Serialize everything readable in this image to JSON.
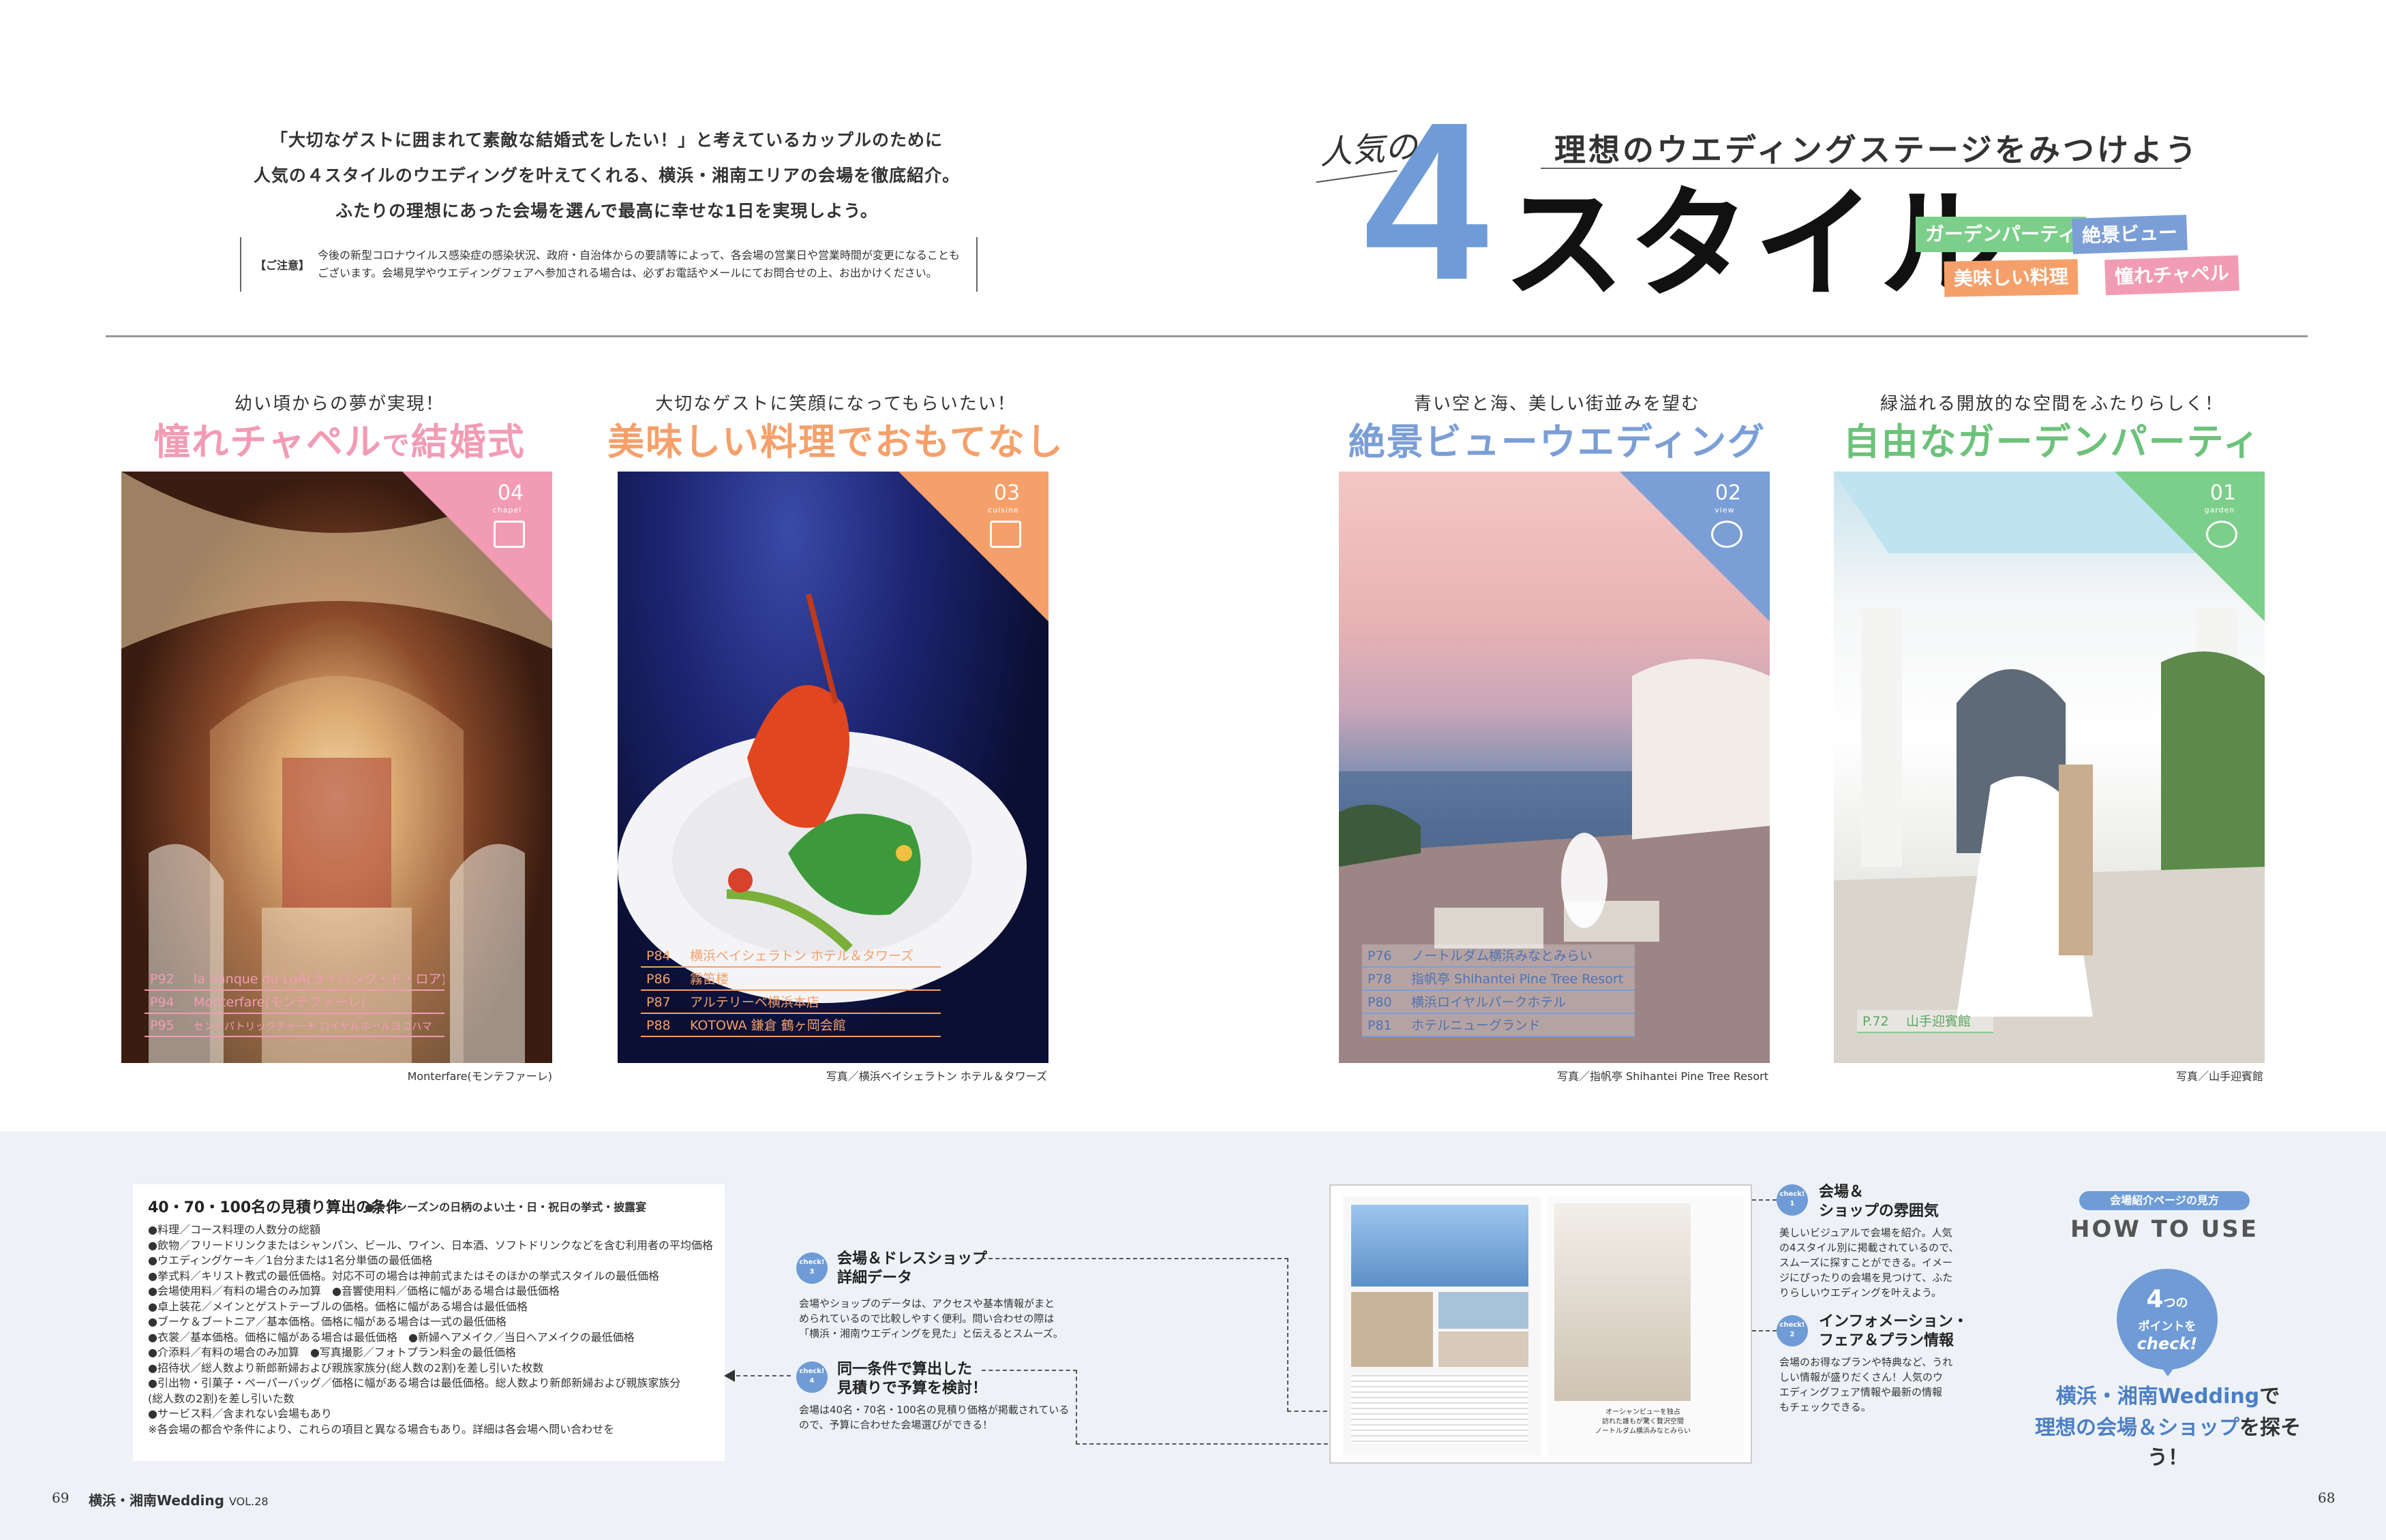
{
  "intro": {
    "line1": "「大切なゲストに囲まれて素敵な結婚式をしたい！」と考えているカップルのために",
    "line2": "人気の４スタイルのウエディングを叶えてくれる、横浜・湘南エリアの会場を徹底紹介。",
    "line3": "ふたりの理想にあった会場を選んで最高に幸せな1日を実現しよう。",
    "notice_label": "【ご注意】",
    "notice_line1": "今後の新型コロナウイルス感染症の感染状況、政府・自治体からの要請等によって、各会場の営業日や営業時間が変更になることも",
    "notice_line2": "ございます。会場見学やウエディングフェアへ参加される場合は、必ずお電話やメールにてお問合せの上、お出かけください。"
  },
  "title": {
    "subtitle": "理想のウエディングステージをみつけよう",
    "ninki": "人気の",
    "big_number": "4",
    "word": "スタイル",
    "tags": [
      "ガーデンパーティ",
      "絶景ビュー",
      "美味しい料理",
      "憧れチャペル"
    ]
  },
  "cards": [
    {
      "sub": "幼い頃からの夢が実現！",
      "title_a": "憧れチャペル",
      "title_b": "で",
      "title_c": "結婚式",
      "number": "04",
      "en": "chapel",
      "pages": [
        {
          "p": "P92",
          "name": "la banque du LoA(ラ・バンク・ド・ロア)"
        },
        {
          "p": "P94",
          "name": "Monterfare(モンテファーレ)"
        },
        {
          "p": "P95",
          "name": "セントパトリックチャーチ ロイヤルホールヨコハマ"
        }
      ],
      "credit": "Monterfare(モンテファーレ)"
    },
    {
      "sub": "大切なゲストに笑顔になってもらいたい！",
      "title_a": "美味しい料理",
      "title_b": "でおもてなし",
      "title_c": "",
      "number": "03",
      "en": "cuisine",
      "pages": [
        {
          "p": "P84",
          "name": "横浜ベイシェラトン ホテル＆タワーズ"
        },
        {
          "p": "P86",
          "name": "霧笛楼"
        },
        {
          "p": "P87",
          "name": "アルテリーベ横浜本店"
        },
        {
          "p": "P88",
          "name": "KOTOWA 鎌倉 鶴ヶ岡会館"
        }
      ],
      "credit": "写真／横浜ベイシェラトン ホテル＆タワーズ"
    },
    {
      "sub": "青い空と海、美しい街並みを望む",
      "title_a": "絶景ビュー",
      "title_b": "ウエディング",
      "title_c": "",
      "number": "02",
      "en": "view",
      "pages": [
        {
          "p": "P76",
          "name": "ノートルダム横浜みなとみらい"
        },
        {
          "p": "P78",
          "name": "指帆亭 Shihantei Pine Tree Resort"
        },
        {
          "p": "P80",
          "name": "横浜ロイヤルパークホテル"
        },
        {
          "p": "P81",
          "name": "ホテルニューグランド"
        }
      ],
      "credit": "写真／指帆亭 Shihantei Pine Tree Resort"
    },
    {
      "sub": "緑溢れる開放的な空間をふたりらしく！",
      "title_a": "自由な",
      "title_b": "ガーデンパーティ",
      "title_c": "",
      "number": "01",
      "en": "garden",
      "pages": [
        {
          "p": "P.72",
          "name": "山手迎賓館"
        }
      ],
      "credit": "写真／山手迎賓館"
    }
  ],
  "conditions": {
    "title": "40・70・100名の見積り算出の条件",
    "note": "●オンシーズンの日柄のよい土・日・祝日の挙式・披露宴",
    "items": [
      "●料理／コース料理の人数分の総額",
      "●飲物／フリードリンクまたはシャンパン、ビール、ワイン、日本酒、ソフトドリンクなどを含む利用者の平均価格",
      "●ウエディングケーキ／1台分または1名分単価の最低価格",
      "●挙式料／キリスト教式の最低価格。対応不可の場合は神前式またはそのほかの挙式スタイルの最低価格",
      "●会場使用料／有料の場合のみ加算　●音響使用料／価格に幅がある場合は最低価格",
      "●卓上装花／メインとゲストテーブルの価格。価格に幅がある場合は最低価格",
      "●ブーケ＆ブートニア／基本価格。価格に幅がある場合は一式の最低価格",
      "●衣裳／基本価格。価格に幅がある場合は最低価格　●新婦ヘアメイク／当日ヘアメイクの最低価格",
      "●介添料／有料の場合のみ加算　●写真撮影／フォトプラン料金の最低価格",
      "●招待状／総人数より新郎新婦および親族家族分(総人数の2割)を差し引いた枚数",
      "●引出物・引菓子・ペーパーバッグ／価格に幅がある場合は最低価格。総人数より新郎新婦および親族家族分",
      "(総人数の2割)を差し引いた数",
      "●サービス料／含まれない会場もあり",
      "※各会場の都合や条件により、これらの項目と異なる場合もあり。詳細は各会場へ問い合わせを"
    ]
  },
  "checks": [
    {
      "badge": "check! 1",
      "title1": "会場＆",
      "title2": "ショップの雰囲気",
      "desc": [
        "美しいビジュアルで会場を紹介。人気",
        "の4スタイル別に掲載されているので、",
        "スムーズに探すことができる。イメー",
        "ジにぴったりの会場を見つけて、ふた",
        "りらしいウエディングを叶えよう。"
      ]
    },
    {
      "badge": "check! 2",
      "title1": "インフォメーション・",
      "title2": "フェア＆プラン情報",
      "desc": [
        "会場のお得なプランや特典など、うれ",
        "しい情報が盛りだくさん！人気のウ",
        "エディングフェア情報や最新の情報",
        "もチェックできる。"
      ]
    },
    {
      "badge": "check! 3",
      "title1": "会場＆ドレスショップ",
      "title2": "詳細データ",
      "desc": [
        "会場やショップのデータは、アクセスや基本情報がまと",
        "められているので比較しやすく便利。問い合わせの際は",
        "「横浜・湘南ウエディングを見た」と伝えるとスムーズ。"
      ]
    },
    {
      "badge": "check! 4",
      "title1": "同一条件で算出した",
      "title2": "見積りで予算を検討！",
      "desc": [
        "会場は40名・70名・100名の見積り価格が掲載されている",
        "ので、予算に合わせた会場選びができる！"
      ]
    }
  ],
  "spread_caption": [
    "オーシャンビューを独占",
    "訪れた誰もが驚く贅沢空間",
    "ノートルダム横浜みなとみらい"
  ],
  "howto": {
    "pill": "会場紹介ページの見方",
    "title": "HOW TO USE",
    "circle_num": "4",
    "circle_num_suffix": "つの",
    "circle_l1": "ポイントを",
    "circle_l2": "check!",
    "cta1_a": "横浜・湘南Wedding",
    "cta1_b": "で",
    "cta2_a": "理想の会場＆ショップ",
    "cta2_b": "を探そう！"
  },
  "footer": {
    "left_page": "69",
    "magazine": "横浜・湘南Wedding",
    "vol": "VOL.28",
    "right_page": "68"
  },
  "colors": {
    "chapel": "#f29bb5",
    "cuisine": "#f5a06a",
    "view": "#7b9ed6",
    "garden": "#7ccf8a",
    "accent": "#6f9cd6"
  }
}
